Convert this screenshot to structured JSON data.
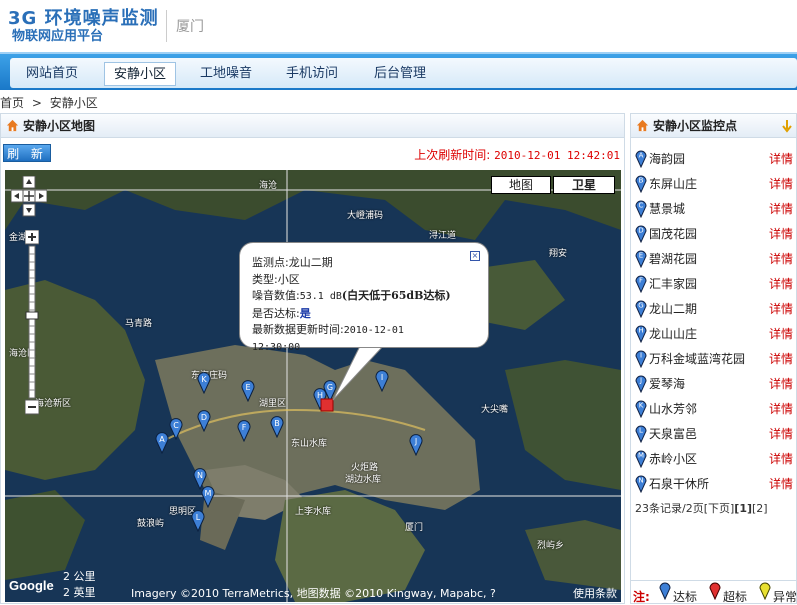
{
  "header": {
    "brand_line1": "3G 环境噪声监测",
    "brand_line2": "物联网应用平台",
    "city": "厦门"
  },
  "nav": {
    "items": [
      {
        "label": "网站首页",
        "active": false
      },
      {
        "label": "安静小区",
        "active": true
      },
      {
        "label": "工地噪音",
        "active": false
      },
      {
        "label": "手机访问",
        "active": false
      },
      {
        "label": "后台管理",
        "active": false
      }
    ]
  },
  "breadcrumb": {
    "home": "首页",
    "sep": ">",
    "current": "安静小区"
  },
  "map_panel": {
    "title": "安静小区地图",
    "refresh_label": "刷 新",
    "last_refresh_label": "上次刷新时间:",
    "last_refresh_value": "2010-12-01 12:42:01",
    "map_type_map": "地图",
    "map_type_satellite": "卫星",
    "popup": {
      "station_label": "监测点:",
      "station_value": "龙山二期",
      "type_label": "类型:",
      "type_value": "小区",
      "noise_label": "噪音数值:",
      "noise_value": "53.1 dB",
      "noise_note": "(白天低于65dB达标)",
      "status_label": "是否达标:",
      "status_value": "是",
      "update_label": "最新数据更新时间:",
      "update_date": "2010-12-01",
      "update_time": "12:30:00"
    },
    "scale_km": "2 公里",
    "scale_mi": "2 英里",
    "copyright": "Imagery ©2010 TerraMetrics, 地图数据 ©2010 Kingway, Mapabc, ?",
    "terms": "使用条款",
    "google": "Google",
    "place_labels": [
      "海沧",
      "大嶝浦码",
      "浔江道",
      "翔安",
      "金湖",
      "马青路",
      "海沧区",
      "东海庄码",
      "湖里区",
      "东山水库",
      "大尖嘴",
      "海沧新区",
      "鼓浪屿",
      "思明区",
      "上李水库",
      "厦门",
      "烈屿乡",
      "火炬路",
      "湖边水库"
    ],
    "markers": [
      {
        "letter": "A",
        "color": "#3d7fd6"
      },
      {
        "letter": "B",
        "color": "#3d7fd6"
      },
      {
        "letter": "C",
        "color": "#3d7fd6"
      },
      {
        "letter": "D",
        "color": "#3d7fd6"
      },
      {
        "letter": "E",
        "color": "#3d7fd6"
      },
      {
        "letter": "F",
        "color": "#3d7fd6"
      },
      {
        "letter": "G",
        "color": "#3d7fd6"
      },
      {
        "letter": "H",
        "color": "#3d7fd6"
      },
      {
        "letter": "I",
        "color": "#3d7fd6"
      },
      {
        "letter": "J",
        "color": "#3d7fd6"
      },
      {
        "letter": "K",
        "color": "#3d7fd6"
      },
      {
        "letter": "L",
        "color": "#3d7fd6"
      },
      {
        "letter": "M",
        "color": "#3d7fd6"
      },
      {
        "letter": "N",
        "color": "#3d7fd6"
      }
    ]
  },
  "sites_panel": {
    "title": "安静小区监控点",
    "detail_label": "详情",
    "items": [
      {
        "letter": "A",
        "name": "海韵园"
      },
      {
        "letter": "B",
        "name": "东屏山庄"
      },
      {
        "letter": "C",
        "name": "慧景城"
      },
      {
        "letter": "D",
        "name": "国茂花园"
      },
      {
        "letter": "E",
        "name": "碧湖花园"
      },
      {
        "letter": "F",
        "name": "汇丰家园"
      },
      {
        "letter": "G",
        "name": "龙山二期"
      },
      {
        "letter": "H",
        "name": "龙山山庄"
      },
      {
        "letter": "I",
        "name": "万科金域蓝湾花园"
      },
      {
        "letter": "J",
        "name": "爱琴海"
      },
      {
        "letter": "K",
        "name": "山水芳邻"
      },
      {
        "letter": "L",
        "name": "天泉富邑"
      },
      {
        "letter": "M",
        "name": "赤岭小区"
      },
      {
        "letter": "N",
        "name": "石泉干休所"
      }
    ],
    "pager": {
      "summary": "23条记录/2页",
      "next": "[下页]",
      "page1": "[1]",
      "page2": "[2]"
    },
    "legend": {
      "note": "注:",
      "ok": "达标",
      "over": "超标",
      "abnormal": "异常",
      "ok_color": "#3d7fd6",
      "over_color": "#e03030",
      "abnormal_color": "#e8e030"
    }
  }
}
